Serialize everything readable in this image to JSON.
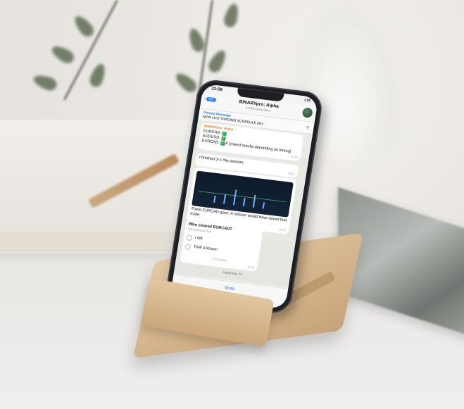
{
  "phone": {
    "status_time": "22:58",
    "status_icons": "LTE",
    "chat": {
      "back_badge": "111",
      "title": "BINARYpro: Alpha",
      "subtitle": "4 028 subscribers"
    },
    "pinned": {
      "label": "Pinned Message",
      "text": "NEW LIVE TRADING SCHEDULE MO..."
    },
    "messages": [
      {
        "sender": "BINARYpro: Alpha",
        "lines": [
          "EURCAD:",
          "AUDUSD:",
          "EURCAD:"
        ],
        "tail": "(mixed results depending on timing)",
        "time": "21:10"
      },
      {
        "text": "I finished 3-1 this session.",
        "time": "21:11"
      },
      {
        "caption": "There EURCAD goes. A rollover would have saved that trade.",
        "time": "21:12"
      }
    ],
    "poll": {
      "question": "Who cleared EURCAD?",
      "type": "Anonymous Poll",
      "options": [
        "I did",
        "Took a lesson"
      ],
      "votes": "213 votes",
      "time": "21:14"
    },
    "date_label": "September 23",
    "mute_label": "Mute"
  },
  "icons": {
    "back": "chevron-left-icon",
    "check": "check-mark-icon",
    "cross": "cross-mark-icon",
    "pin": "pin-icon"
  },
  "colors": {
    "accent": "#2a7ef0",
    "check": "#33a853",
    "wood": "#d4b48c"
  }
}
